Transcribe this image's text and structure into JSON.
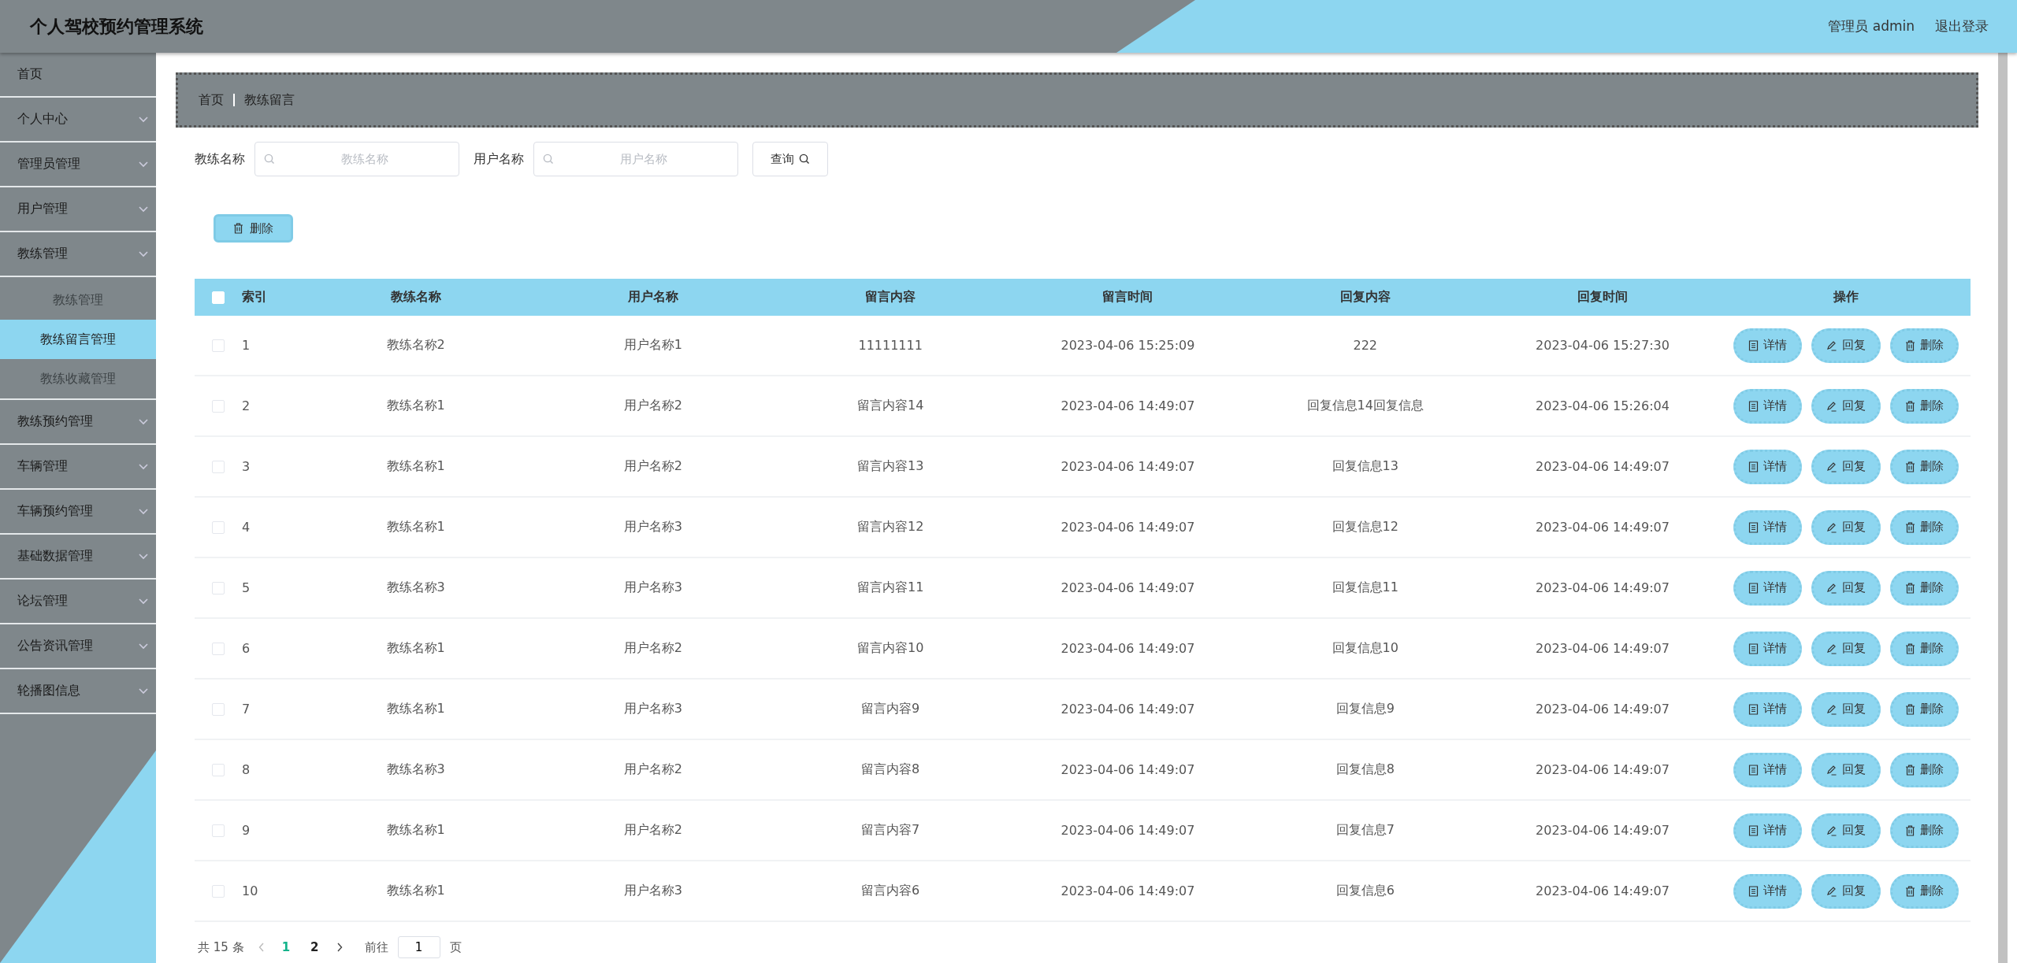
{
  "header": {
    "title": "个人驾校预约管理系统",
    "user": "管理员 admin",
    "logout": "退出登录"
  },
  "sidebar": {
    "items": [
      {
        "label": "首页",
        "kind": "link"
      },
      {
        "label": "个人中心",
        "kind": "menu"
      },
      {
        "label": "管理员管理",
        "kind": "menu"
      },
      {
        "label": "用户管理",
        "kind": "menu"
      },
      {
        "label": "教练管理",
        "kind": "menu",
        "children": [
          {
            "label": "教练管理",
            "selected": false
          },
          {
            "label": "教练留言管理",
            "selected": true
          },
          {
            "label": "教练收藏管理",
            "selected": false
          }
        ]
      },
      {
        "label": "教练预约管理",
        "kind": "menu"
      },
      {
        "label": "车辆管理",
        "kind": "menu"
      },
      {
        "label": "车辆预约管理",
        "kind": "menu"
      },
      {
        "label": "基础数据管理",
        "kind": "menu"
      },
      {
        "label": "论坛管理",
        "kind": "menu"
      },
      {
        "label": "公告资讯管理",
        "kind": "menu"
      },
      {
        "label": "轮播图信息",
        "kind": "menu"
      }
    ]
  },
  "breadcrumb": [
    "首页",
    "教练留言"
  ],
  "search": {
    "fields": [
      {
        "label": "教练名称",
        "placeholder": "教练名称"
      },
      {
        "label": "用户名称",
        "placeholder": "用户名称"
      }
    ],
    "button": "查询"
  },
  "toolbar": {
    "delete": "删除"
  },
  "table": {
    "header_checked": false,
    "columns": [
      "索引",
      "教练名称",
      "用户名称",
      "留言内容",
      "留言时间",
      "回复内容",
      "回复时间",
      "操作"
    ],
    "rows": [
      {
        "checked": false,
        "cells": [
          "1",
          "教练名称2",
          "用户名称1",
          "11111111",
          "2023-04-06 15:25:09",
          "222",
          "2023-04-06 15:27:30"
        ],
        "actions": [
          "详情",
          "回复",
          "删除"
        ]
      },
      {
        "checked": false,
        "cells": [
          "2",
          "教练名称1",
          "用户名称2",
          "留言内容14",
          "2023-04-06 14:49:07",
          "回复信息14回复信息",
          "2023-04-06 15:26:04"
        ],
        "actions": [
          "详情",
          "回复",
          "删除"
        ]
      },
      {
        "checked": false,
        "cells": [
          "3",
          "教练名称1",
          "用户名称2",
          "留言内容13",
          "2023-04-06 14:49:07",
          "回复信息13",
          "2023-04-06 14:49:07"
        ],
        "actions": [
          "详情",
          "回复",
          "删除"
        ]
      },
      {
        "checked": false,
        "cells": [
          "4",
          "教练名称1",
          "用户名称3",
          "留言内容12",
          "2023-04-06 14:49:07",
          "回复信息12",
          "2023-04-06 14:49:07"
        ],
        "actions": [
          "详情",
          "回复",
          "删除"
        ]
      },
      {
        "checked": false,
        "cells": [
          "5",
          "教练名称3",
          "用户名称3",
          "留言内容11",
          "2023-04-06 14:49:07",
          "回复信息11",
          "2023-04-06 14:49:07"
        ],
        "actions": [
          "详情",
          "回复",
          "删除"
        ]
      },
      {
        "checked": false,
        "cells": [
          "6",
          "教练名称1",
          "用户名称2",
          "留言内容10",
          "2023-04-06 14:49:07",
          "回复信息10",
          "2023-04-06 14:49:07"
        ],
        "actions": [
          "详情",
          "回复",
          "删除"
        ]
      },
      {
        "checked": false,
        "cells": [
          "7",
          "教练名称1",
          "用户名称3",
          "留言内容9",
          "2023-04-06 14:49:07",
          "回复信息9",
          "2023-04-06 14:49:07"
        ],
        "actions": [
          "详情",
          "回复",
          "删除"
        ]
      },
      {
        "checked": false,
        "cells": [
          "8",
          "教练名称3",
          "用户名称2",
          "留言内容8",
          "2023-04-06 14:49:07",
          "回复信息8",
          "2023-04-06 14:49:07"
        ],
        "actions": [
          "详情",
          "回复",
          "删除"
        ]
      },
      {
        "checked": false,
        "cells": [
          "9",
          "教练名称1",
          "用户名称2",
          "留言内容7",
          "2023-04-06 14:49:07",
          "回复信息7",
          "2023-04-06 14:49:07"
        ],
        "actions": [
          "详情",
          "回复",
          "删除"
        ]
      },
      {
        "checked": false,
        "cells": [
          "10",
          "教练名称1",
          "用户名称3",
          "留言内容6",
          "2023-04-06 14:49:07",
          "回复信息6",
          "2023-04-06 14:49:07"
        ],
        "actions": [
          "详情",
          "回复",
          "删除"
        ]
      }
    ]
  },
  "pagination": {
    "total": "共 15 条",
    "pages": [
      {
        "label": "1",
        "selected": true
      },
      {
        "label": "2",
        "selected": false
      }
    ],
    "goto": "前往",
    "page_value": "1",
    "page_unit": "页"
  }
}
